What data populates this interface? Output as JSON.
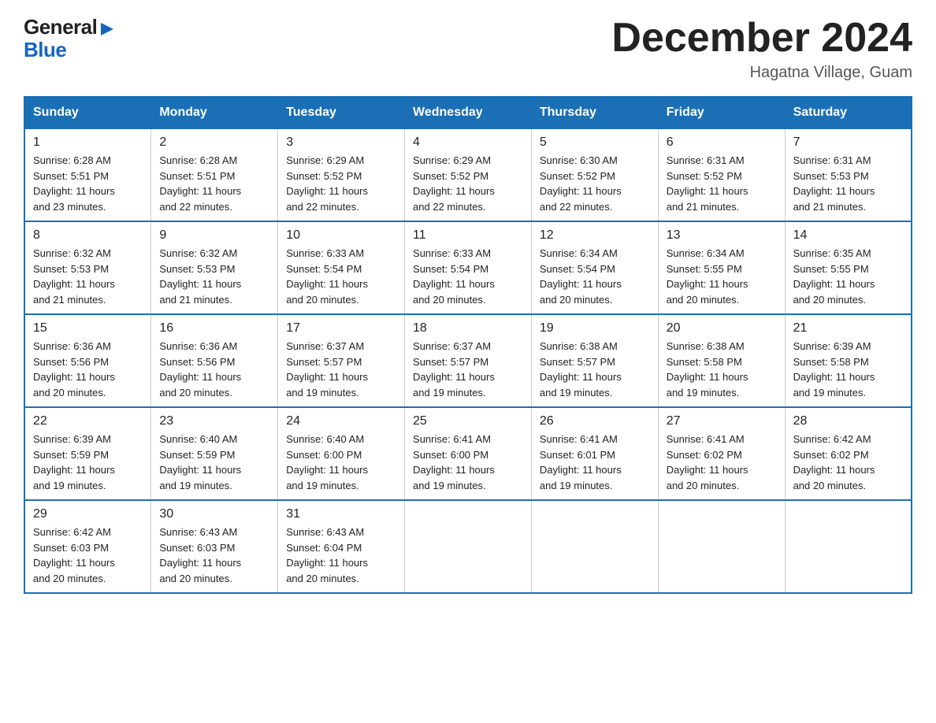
{
  "header": {
    "logo_general": "General",
    "logo_blue": "Blue",
    "month_title": "December 2024",
    "location": "Hagatna Village, Guam"
  },
  "days_of_week": [
    "Sunday",
    "Monday",
    "Tuesday",
    "Wednesday",
    "Thursday",
    "Friday",
    "Saturday"
  ],
  "weeks": [
    [
      {
        "day": "1",
        "sunrise": "6:28 AM",
        "sunset": "5:51 PM",
        "daylight": "11 hours and 23 minutes."
      },
      {
        "day": "2",
        "sunrise": "6:28 AM",
        "sunset": "5:51 PM",
        "daylight": "11 hours and 22 minutes."
      },
      {
        "day": "3",
        "sunrise": "6:29 AM",
        "sunset": "5:52 PM",
        "daylight": "11 hours and 22 minutes."
      },
      {
        "day": "4",
        "sunrise": "6:29 AM",
        "sunset": "5:52 PM",
        "daylight": "11 hours and 22 minutes."
      },
      {
        "day": "5",
        "sunrise": "6:30 AM",
        "sunset": "5:52 PM",
        "daylight": "11 hours and 22 minutes."
      },
      {
        "day": "6",
        "sunrise": "6:31 AM",
        "sunset": "5:52 PM",
        "daylight": "11 hours and 21 minutes."
      },
      {
        "day": "7",
        "sunrise": "6:31 AM",
        "sunset": "5:53 PM",
        "daylight": "11 hours and 21 minutes."
      }
    ],
    [
      {
        "day": "8",
        "sunrise": "6:32 AM",
        "sunset": "5:53 PM",
        "daylight": "11 hours and 21 minutes."
      },
      {
        "day": "9",
        "sunrise": "6:32 AM",
        "sunset": "5:53 PM",
        "daylight": "11 hours and 21 minutes."
      },
      {
        "day": "10",
        "sunrise": "6:33 AM",
        "sunset": "5:54 PM",
        "daylight": "11 hours and 20 minutes."
      },
      {
        "day": "11",
        "sunrise": "6:33 AM",
        "sunset": "5:54 PM",
        "daylight": "11 hours and 20 minutes."
      },
      {
        "day": "12",
        "sunrise": "6:34 AM",
        "sunset": "5:54 PM",
        "daylight": "11 hours and 20 minutes."
      },
      {
        "day": "13",
        "sunrise": "6:34 AM",
        "sunset": "5:55 PM",
        "daylight": "11 hours and 20 minutes."
      },
      {
        "day": "14",
        "sunrise": "6:35 AM",
        "sunset": "5:55 PM",
        "daylight": "11 hours and 20 minutes."
      }
    ],
    [
      {
        "day": "15",
        "sunrise": "6:36 AM",
        "sunset": "5:56 PM",
        "daylight": "11 hours and 20 minutes."
      },
      {
        "day": "16",
        "sunrise": "6:36 AM",
        "sunset": "5:56 PM",
        "daylight": "11 hours and 20 minutes."
      },
      {
        "day": "17",
        "sunrise": "6:37 AM",
        "sunset": "5:57 PM",
        "daylight": "11 hours and 19 minutes."
      },
      {
        "day": "18",
        "sunrise": "6:37 AM",
        "sunset": "5:57 PM",
        "daylight": "11 hours and 19 minutes."
      },
      {
        "day": "19",
        "sunrise": "6:38 AM",
        "sunset": "5:57 PM",
        "daylight": "11 hours and 19 minutes."
      },
      {
        "day": "20",
        "sunrise": "6:38 AM",
        "sunset": "5:58 PM",
        "daylight": "11 hours and 19 minutes."
      },
      {
        "day": "21",
        "sunrise": "6:39 AM",
        "sunset": "5:58 PM",
        "daylight": "11 hours and 19 minutes."
      }
    ],
    [
      {
        "day": "22",
        "sunrise": "6:39 AM",
        "sunset": "5:59 PM",
        "daylight": "11 hours and 19 minutes."
      },
      {
        "day": "23",
        "sunrise": "6:40 AM",
        "sunset": "5:59 PM",
        "daylight": "11 hours and 19 minutes."
      },
      {
        "day": "24",
        "sunrise": "6:40 AM",
        "sunset": "6:00 PM",
        "daylight": "11 hours and 19 minutes."
      },
      {
        "day": "25",
        "sunrise": "6:41 AM",
        "sunset": "6:00 PM",
        "daylight": "11 hours and 19 minutes."
      },
      {
        "day": "26",
        "sunrise": "6:41 AM",
        "sunset": "6:01 PM",
        "daylight": "11 hours and 19 minutes."
      },
      {
        "day": "27",
        "sunrise": "6:41 AM",
        "sunset": "6:02 PM",
        "daylight": "11 hours and 20 minutes."
      },
      {
        "day": "28",
        "sunrise": "6:42 AM",
        "sunset": "6:02 PM",
        "daylight": "11 hours and 20 minutes."
      }
    ],
    [
      {
        "day": "29",
        "sunrise": "6:42 AM",
        "sunset": "6:03 PM",
        "daylight": "11 hours and 20 minutes."
      },
      {
        "day": "30",
        "sunrise": "6:43 AM",
        "sunset": "6:03 PM",
        "daylight": "11 hours and 20 minutes."
      },
      {
        "day": "31",
        "sunrise": "6:43 AM",
        "sunset": "6:04 PM",
        "daylight": "11 hours and 20 minutes."
      },
      null,
      null,
      null,
      null
    ]
  ],
  "labels": {
    "sunrise": "Sunrise:",
    "sunset": "Sunset:",
    "daylight": "Daylight:"
  }
}
